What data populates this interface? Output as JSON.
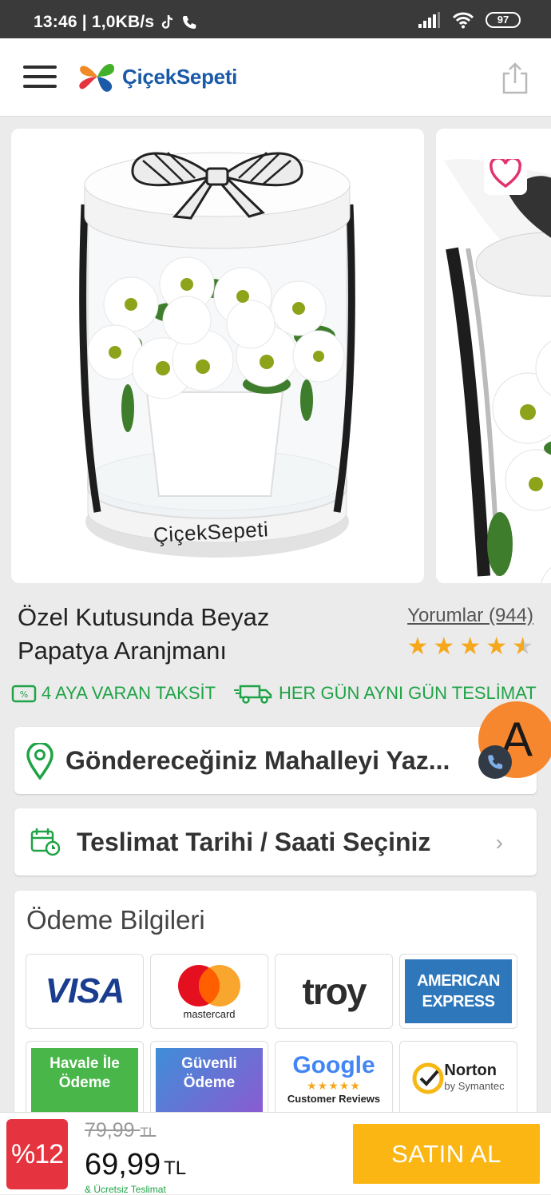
{
  "status_bar": {
    "time_speed": "13:46 | 1,0KB/s",
    "battery": "97"
  },
  "header": {
    "brand": "ÇiçekSepeti"
  },
  "product": {
    "title": "Özel Kutusunda Beyaz Papatya Aranjmanı",
    "reviews_label": "Yorumlar (944)",
    "rating": 4.5,
    "box_brand": "ÇiçekSepeti"
  },
  "promos": {
    "installment": "4 AYA VARAN TAKSİT",
    "delivery": "HER GÜN AYNI GÜN TESLİMAT"
  },
  "address": {
    "placeholder": "Göndereceğiniz Mahalleyi Yaz..."
  },
  "delivery_date": {
    "label": "Teslimat Tarihi / Saati Seçiniz"
  },
  "payment": {
    "title": "Ödeme Bilgileri",
    "logos": {
      "visa": "VISA",
      "mastercard": "mastercard",
      "troy": "troy",
      "amex_line1": "AMERICAN",
      "amex_line2": "EXPRESS",
      "havale_line1": "Havale İle",
      "havale_line2": "Ödeme",
      "guvenli_line1": "Güvenli",
      "guvenli_line2": "Ödeme",
      "google": "Google",
      "google_sub": "Customer Reviews",
      "norton": "Norton",
      "norton_sub": "by Symantec"
    }
  },
  "assistant_fab": "A",
  "bottom_bar": {
    "discount": "%12",
    "old_price": "79,99",
    "old_currency": "TL",
    "new_price": "69,99",
    "currency": "TL",
    "free_delivery": "& Ücretsiz Teslimat",
    "buy_label": "SATIN AL"
  },
  "colors": {
    "brand_blue": "#1a5aa7",
    "green": "#1fa346",
    "star": "#f6a81d",
    "buy_button": "#fbb614",
    "discount_badge": "#e5343f",
    "assistant_fab": "#f7872f"
  }
}
